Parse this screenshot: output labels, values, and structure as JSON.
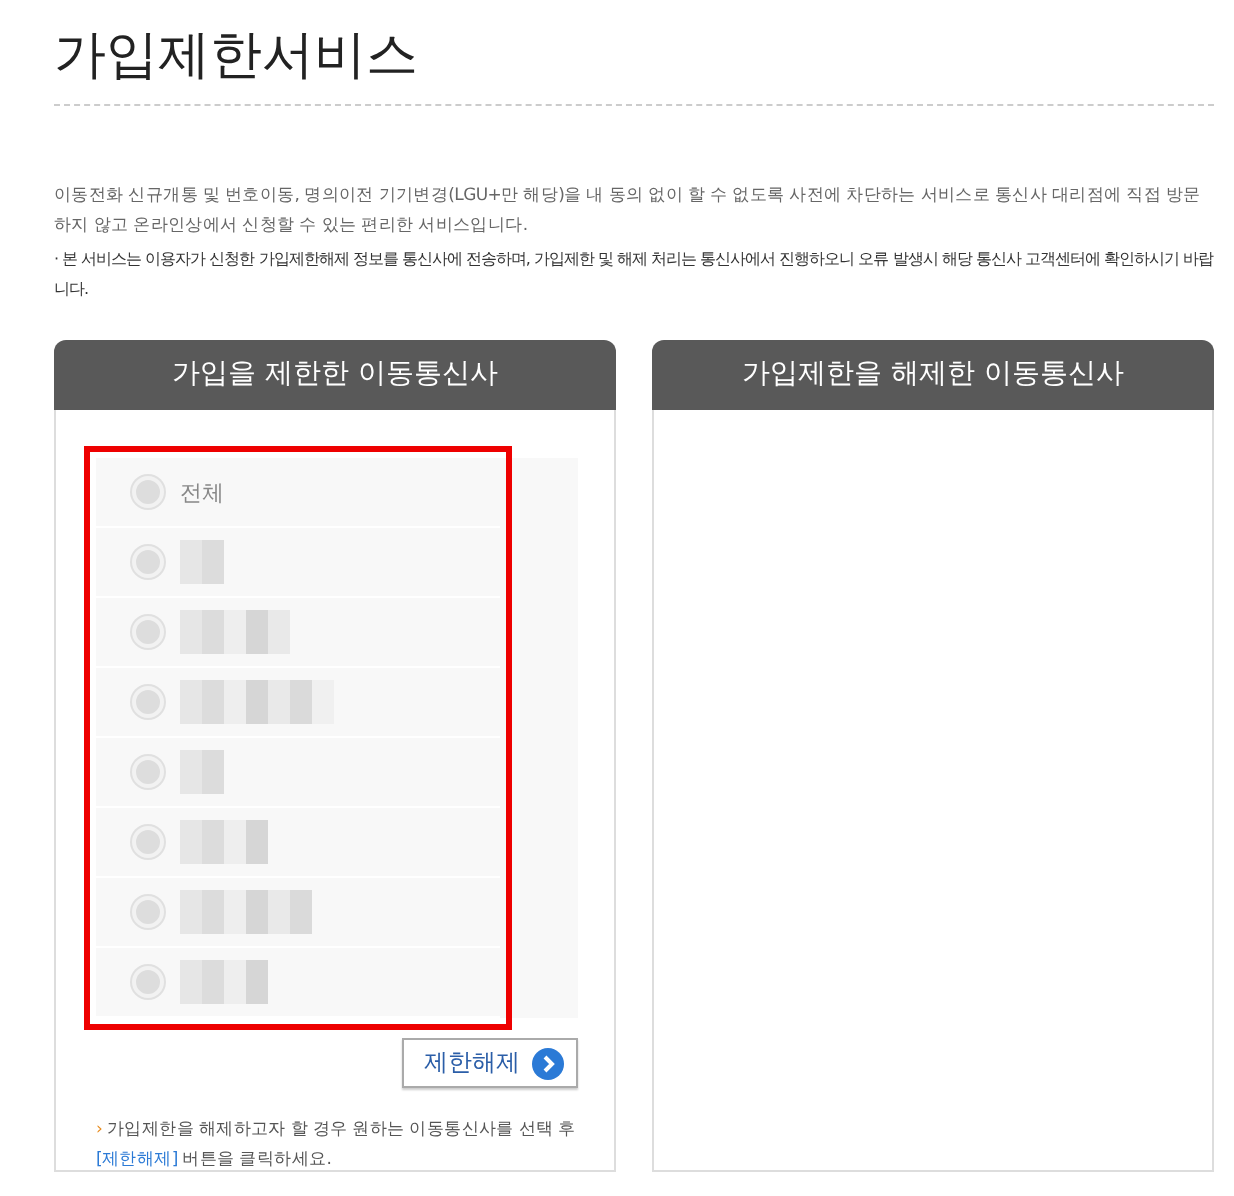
{
  "title": "가입제한서비스",
  "description": "이동전화 신규개통 및 번호이동, 명의이전 기기변경(LGU+만 해당)을 내 동의 없이 할 수 없도록 사전에 차단하는 서비스로 통신사 대리점에 직접 방문하지 않고 온라인상에서 신청할 수 있는 편리한 서비스입니다.",
  "notice": "· 본 서비스는 이용자가 신청한 가입제한해제 정보를 통신사에 전송하며, 가입제한 및 해제 처리는 통신사에서 진행하오니 오류 발생시 해당 통신사 고객센터에 확인하시기 바랍니다.",
  "panels": [
    {
      "title": "가입을 제한한 이동통신사",
      "highlight": true,
      "options": [
        {
          "kind": "text",
          "label": "전체",
          "selected": false
        },
        {
          "kind": "redacted",
          "selected": false
        },
        {
          "kind": "redacted",
          "selected": false
        },
        {
          "kind": "redacted",
          "selected": false
        },
        {
          "kind": "redacted",
          "selected": false
        },
        {
          "kind": "redacted",
          "selected": false
        },
        {
          "kind": "redacted",
          "selected": false
        },
        {
          "kind": "redacted",
          "selected": false
        }
      ],
      "button": "제한해제",
      "note": {
        "marker": "›",
        "text": "가입제한을 해제하고자 할 경우 원하는 이동통신사를 선택 후",
        "link": "[제한해제]",
        "tail": "버튼을 클릭하세요."
      }
    },
    {
      "title": "가입제한을 해제한 이동통신사"
    }
  ]
}
